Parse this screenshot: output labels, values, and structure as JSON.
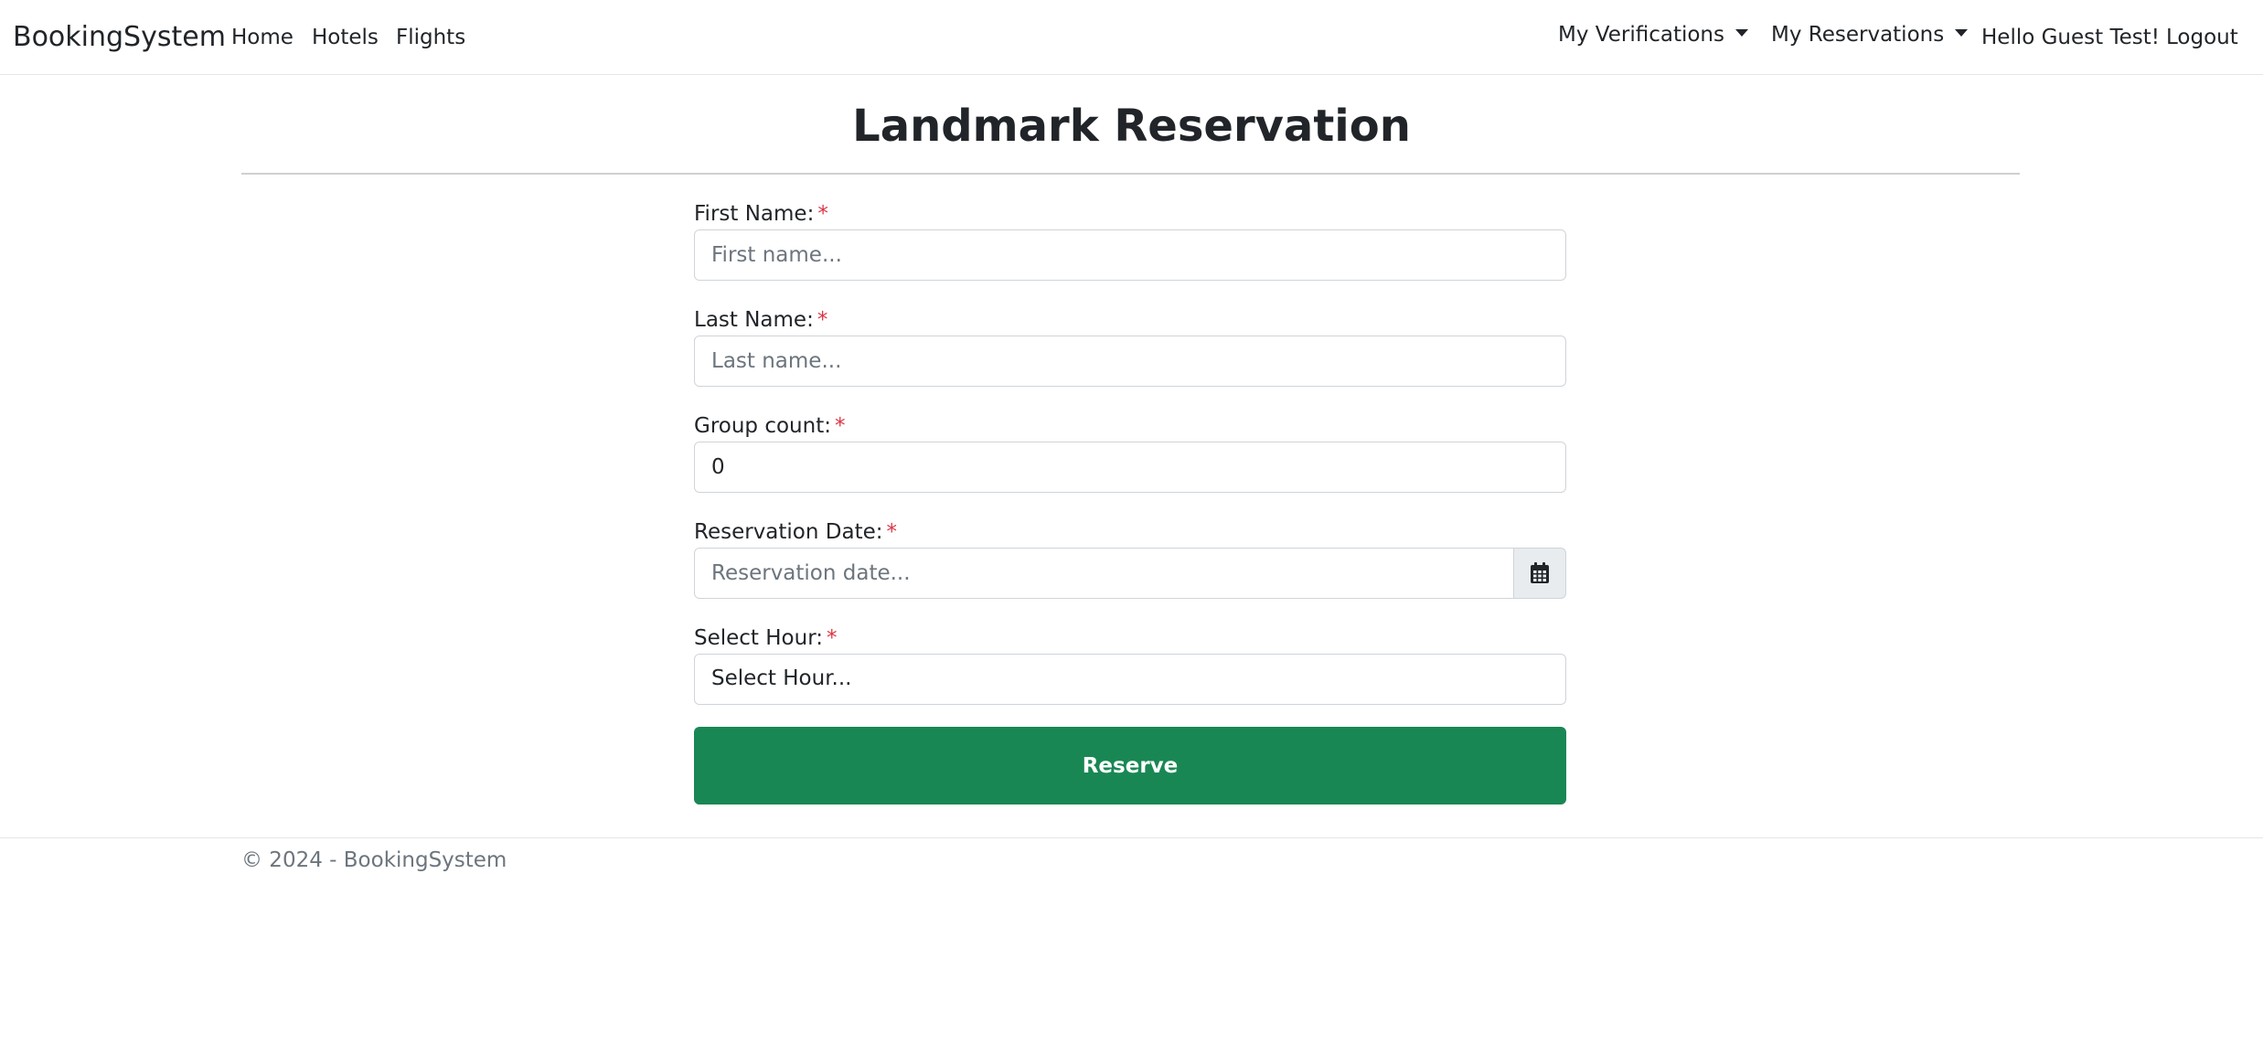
{
  "navbar": {
    "brand": "BookingSystem",
    "links": [
      {
        "label": "Home"
      },
      {
        "label": "Hotels"
      },
      {
        "label": "Flights"
      }
    ],
    "dropdowns": [
      {
        "label": "My Verifications"
      },
      {
        "label": "My Reservations"
      }
    ],
    "greeting": "Hello Guest Test!",
    "logout": "Logout"
  },
  "page": {
    "title": "Landmark Reservation"
  },
  "form": {
    "required_marker": "*",
    "first_name": {
      "label": "First Name:",
      "placeholder": "First name...",
      "value": ""
    },
    "last_name": {
      "label": "Last Name:",
      "placeholder": "Last name...",
      "value": ""
    },
    "group_count": {
      "label": "Group count:",
      "value": "0"
    },
    "reservation_date": {
      "label": "Reservation Date:",
      "placeholder": "Reservation date...",
      "value": "",
      "icon": "calendar-icon"
    },
    "select_hour": {
      "label": "Select Hour:",
      "selected": "Select Hour..."
    },
    "submit_label": "Reserve"
  },
  "footer": {
    "text": "© 2024 - BookingSystem"
  },
  "colors": {
    "accent_green": "#198754",
    "required_red": "#dc3545",
    "muted_text": "#6c757d",
    "border": "#ced4da"
  }
}
